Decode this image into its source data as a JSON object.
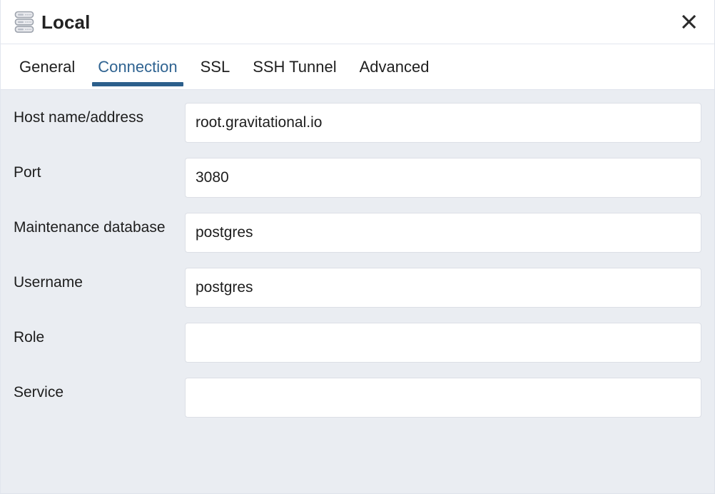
{
  "window": {
    "title": "Local",
    "icon": "server-stack-icon",
    "close_label": "✕"
  },
  "tabs": [
    {
      "label": "General",
      "active": false
    },
    {
      "label": "Connection",
      "active": true
    },
    {
      "label": "SSL",
      "active": false
    },
    {
      "label": "SSH Tunnel",
      "active": false
    },
    {
      "label": "Advanced",
      "active": false
    }
  ],
  "form": {
    "fields": [
      {
        "label": "Host name/address",
        "value": "root.gravitational.io",
        "placeholder": ""
      },
      {
        "label": "Port",
        "value": "3080",
        "placeholder": ""
      },
      {
        "label": "Maintenance database",
        "value": "postgres",
        "placeholder": ""
      },
      {
        "label": "Username",
        "value": "postgres",
        "placeholder": ""
      },
      {
        "label": "Role",
        "value": "",
        "placeholder": ""
      },
      {
        "label": "Service",
        "value": "",
        "placeholder": ""
      }
    ]
  },
  "colors": {
    "accent": "#2c5f8c",
    "active_tab_text": "#2f6391",
    "body_background": "#eaedf2",
    "input_background": "#ffffff",
    "input_border": "#dcdfe6",
    "text": "#1d1d1d"
  }
}
